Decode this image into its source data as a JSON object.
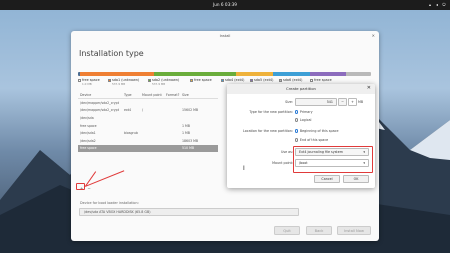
{
  "topbar": {
    "clock": "Jun 6  03:39"
  },
  "window": {
    "title": "Install",
    "heading": "Installation type"
  },
  "partition_bar": {
    "segments": [
      {
        "color": "#4b6b8f",
        "flex": 1
      },
      {
        "color": "#ef7f33",
        "flex": 36
      },
      {
        "color": "#6aad3b",
        "flex": 40
      },
      {
        "color": "#efb23b",
        "flex": 18
      },
      {
        "color": "#3d9fd6",
        "flex": 18
      },
      {
        "color": "#8c6cbd",
        "flex": 18
      },
      {
        "color": "#b9b9b9",
        "flex": 12
      }
    ]
  },
  "legend": [
    {
      "label": "free space",
      "size": "1.0 MB",
      "color": "#ffffff"
    },
    {
      "label": "sda1 (unknown)",
      "size": "537.9 MB",
      "color": "#ef7f33"
    },
    {
      "label": "sda2 (unknown)",
      "size": "537.9 MB",
      "color": "#6aad3b"
    },
    {
      "label": "free space",
      "size": "",
      "color": "#efb23b"
    },
    {
      "label": "sda4 (ext4)",
      "size": "",
      "color": "#3d9fd6"
    },
    {
      "label": "sda5 (ext4)",
      "size": "",
      "color": "#8c6cbd"
    },
    {
      "label": "sda6 (ext4)",
      "size": "",
      "color": "#bcbcbc"
    },
    {
      "label": "free space",
      "size": "",
      "color": "#ffffff"
    }
  ],
  "table": {
    "headers": [
      "Device",
      "Type",
      "Mount point",
      "Format?",
      "Size"
    ],
    "rows": [
      {
        "device": "/dev/mapper/sda2_crypt",
        "type": "",
        "mount": "",
        "format": "",
        "size": "",
        "sel": false
      },
      {
        "device": "  /dev/mapper/sda2_crypt",
        "type": "ext4",
        "mount": "/",
        "format": "",
        "size": "15602 MB",
        "sel": false
      },
      {
        "device": "/dev/sda",
        "type": "",
        "mount": "",
        "format": "",
        "size": "",
        "sel": false
      },
      {
        "device": "  free space",
        "type": "",
        "mount": "",
        "format": "",
        "size": "1 MB",
        "sel": false
      },
      {
        "device": "  /dev/sda1",
        "type": "biosgrub",
        "mount": "",
        "format": "",
        "size": "1 MB",
        "sel": false
      },
      {
        "device": "  /dev/sda2",
        "type": "",
        "mount": "",
        "format": "",
        "size": "18603 MB",
        "sel": false
      },
      {
        "device": "  free space",
        "type": "",
        "mount": "",
        "format": "",
        "size": "510 MB",
        "sel": true
      }
    ]
  },
  "controls": {
    "add": "+",
    "remove": "−",
    "change": "Change..."
  },
  "boot": {
    "label": "Device for boot loader installation:",
    "value": "/dev/sda    ATA VBOX HARDDISK (65.8 GB)"
  },
  "buttons": {
    "quit": "Quit",
    "back": "Back",
    "install": "Install Now"
  },
  "dialog": {
    "title": "Create partition",
    "size_label": "Size:",
    "size_value": "541",
    "size_unit": "MB",
    "minus": "−",
    "plus": "+",
    "type_label": "Type for the new partition:",
    "type_primary": "Primary",
    "type_logical": "Logical",
    "loc_label": "Location for the new partition:",
    "loc_begin": "Beginning of this space",
    "loc_end": "End of this space",
    "use_label": "Use as:",
    "use_value": "Ext4 journaling file system",
    "mount_label": "Mount point:",
    "mount_value": "/boot",
    "cancel": "Cancel",
    "ok": "OK"
  }
}
